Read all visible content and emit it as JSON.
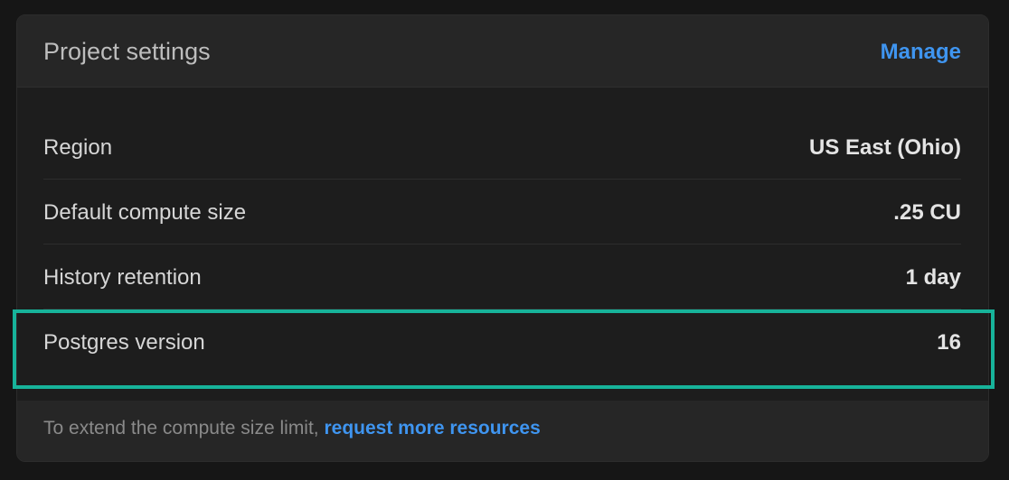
{
  "header": {
    "title": "Project settings",
    "manage_label": "Manage"
  },
  "settings": [
    {
      "label": "Region",
      "value": "US East (Ohio)"
    },
    {
      "label": "Default compute size",
      "value": ".25 CU"
    },
    {
      "label": "History retention",
      "value": "1 day"
    },
    {
      "label": "Postgres version",
      "value": "16"
    }
  ],
  "footer": {
    "text": "To extend the compute size limit, ",
    "link_label": "request more resources"
  },
  "colors": {
    "accent_link": "#3f95f0",
    "highlight_border": "#17b39a"
  }
}
